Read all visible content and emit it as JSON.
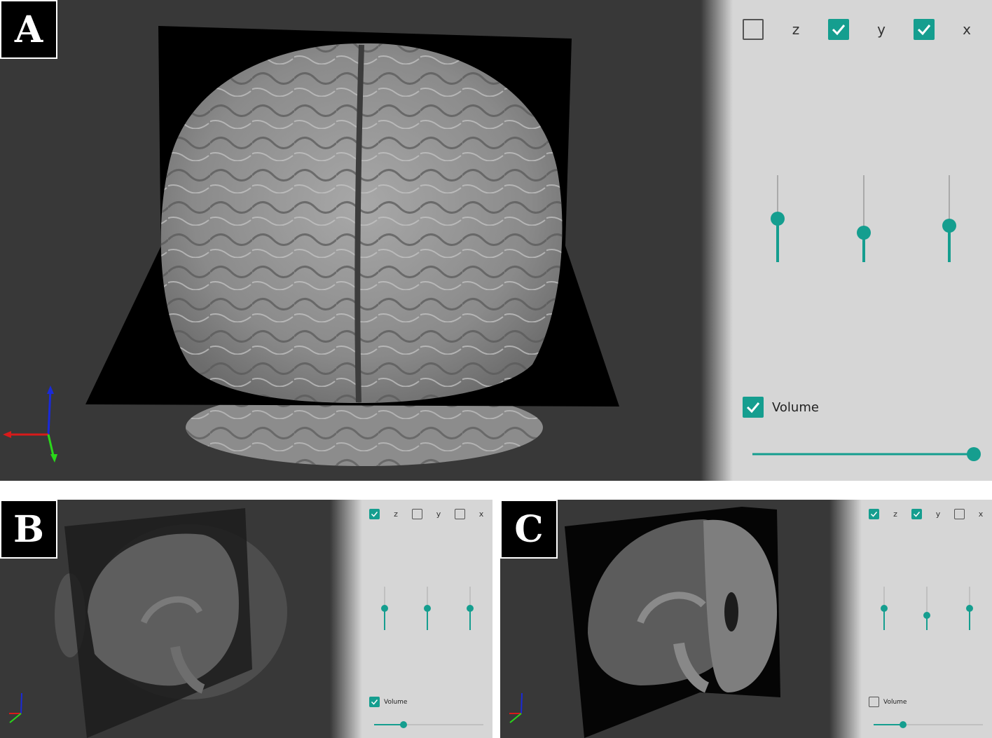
{
  "colors": {
    "accent": "#159e8f",
    "viewport_bg": "#383838",
    "panel_bg": "#d6d6d6"
  },
  "panels": [
    {
      "id": "a",
      "label": "A",
      "view": "3D brain surface with orthogonal slice planes",
      "checks": [
        {
          "axis": "z",
          "checked": false
        },
        {
          "axis": "y",
          "checked": true
        },
        {
          "axis": "x",
          "checked": true
        }
      ],
      "sliders": [
        {
          "axis": "z",
          "value": 0.5
        },
        {
          "axis": "y",
          "value": 0.34
        },
        {
          "axis": "x",
          "value": 0.42
        }
      ],
      "volume": {
        "label": "Volume",
        "checked": true,
        "value": 1.0
      }
    },
    {
      "id": "b",
      "label": "B",
      "view": "semi-transparent volume with sagittal slice",
      "checks": [
        {
          "axis": "z",
          "checked": true
        },
        {
          "axis": "y",
          "checked": false
        },
        {
          "axis": "x",
          "checked": false
        }
      ],
      "sliders": [
        {
          "axis": "z",
          "value": 0.5
        },
        {
          "axis": "y",
          "value": 0.5
        },
        {
          "axis": "x",
          "value": 0.5
        }
      ],
      "volume": {
        "label": "Volume",
        "checked": true,
        "value": 0.27
      }
    },
    {
      "id": "c",
      "label": "C",
      "view": "sagittal and coronal slices",
      "checks": [
        {
          "axis": "z",
          "checked": true
        },
        {
          "axis": "y",
          "checked": true
        },
        {
          "axis": "x",
          "checked": false
        }
      ],
      "sliders": [
        {
          "axis": "z",
          "value": 0.5
        },
        {
          "axis": "y",
          "value": 0.33
        },
        {
          "axis": "x",
          "value": 0.5
        }
      ],
      "volume": {
        "label": "Volume",
        "checked": false,
        "value": 0.27
      }
    }
  ]
}
